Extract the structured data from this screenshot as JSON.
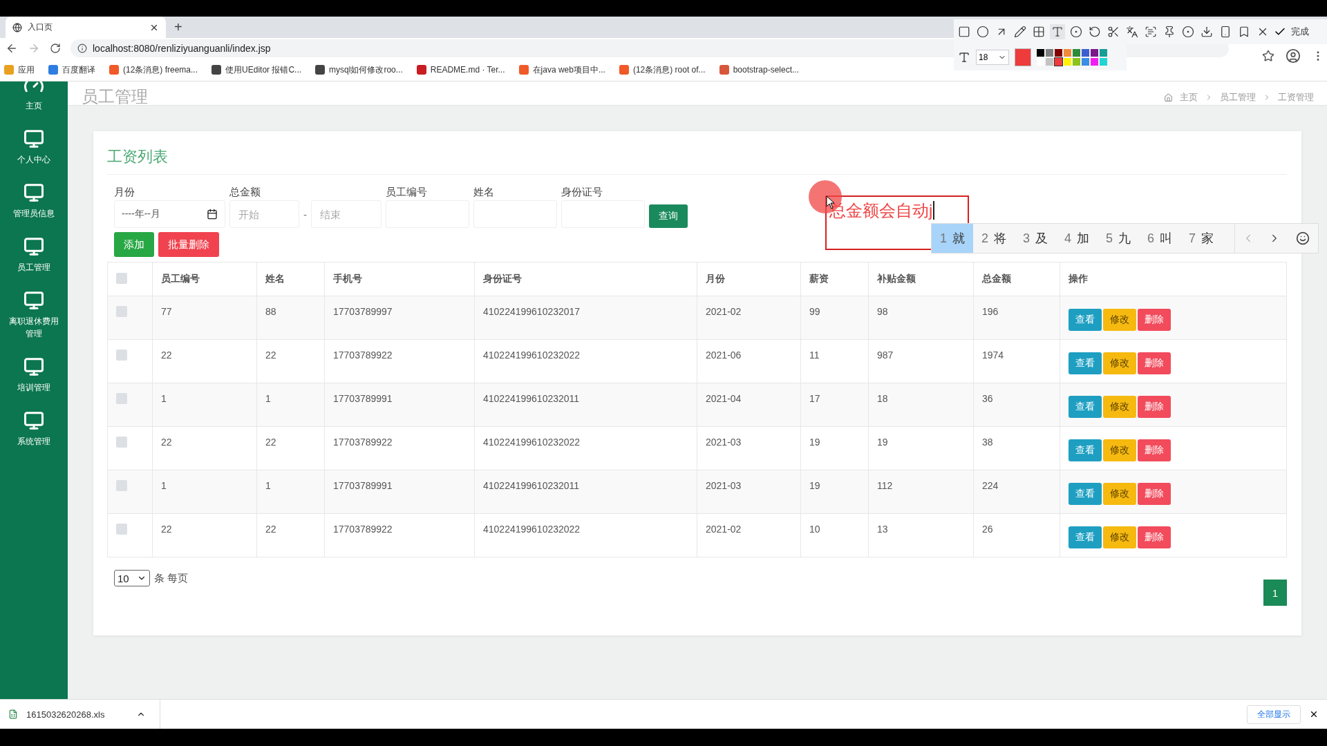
{
  "browser": {
    "tab_title": "入口页",
    "new_tab": "+",
    "url": "localhost:8080/renliziyuanguanli/index.jsp",
    "bookmarks": [
      {
        "label": "应用",
        "kind": "apps"
      },
      {
        "label": "百度翻译",
        "kind": "translate"
      },
      {
        "label": "(12条消息) freema...",
        "kind": "blog"
      },
      {
        "label": "使用UEditor 报错C...",
        "kind": "script"
      },
      {
        "label": "mysql如何修改roo...",
        "kind": "script"
      },
      {
        "label": "README.md · Ter...",
        "kind": "gitee"
      },
      {
        "label": "在java web项目中...",
        "kind": "blog"
      },
      {
        "label": "(12条消息) root of...",
        "kind": "blog"
      },
      {
        "label": "bootstrap-select...",
        "kind": "doc"
      }
    ]
  },
  "capture_toolbar": {
    "done_label": "完成",
    "font_size": "18",
    "palette": [
      {
        "color": "#000000",
        "selected": false
      },
      {
        "color": "#7f7f7f",
        "selected": false
      },
      {
        "color": "#7f0000",
        "selected": false
      },
      {
        "color": "#f08a3c",
        "selected": false
      },
      {
        "color": "#2e8b3c",
        "selected": false
      },
      {
        "color": "#3c5fd0",
        "selected": false
      },
      {
        "color": "#7a1a8a",
        "selected": false
      },
      {
        "color": "#159e96",
        "selected": false
      },
      {
        "color": "#ffffff",
        "selected": false
      },
      {
        "color": "#c3c3c3",
        "selected": false
      },
      {
        "color": "#ee3b3b",
        "selected": true
      },
      {
        "color": "#fff200",
        "selected": false
      },
      {
        "color": "#8cc21a",
        "selected": false
      },
      {
        "color": "#3a8ee6",
        "selected": false
      },
      {
        "color": "#f01ef0",
        "selected": false
      },
      {
        "color": "#22d4d4",
        "selected": false
      }
    ]
  },
  "sidebar": {
    "items": [
      {
        "label": "主页",
        "kind": "home",
        "selected": false
      },
      {
        "label": "个人中心",
        "kind": "monitor",
        "selected": false
      },
      {
        "label": "管理员信息",
        "kind": "monitor",
        "selected": false
      },
      {
        "label": "员工管理",
        "kind": "monitor",
        "selected": false
      },
      {
        "label": "离职退休费用管理",
        "kind": "monitor",
        "selected": false
      },
      {
        "label": "培训管理",
        "kind": "monitor",
        "selected": false
      },
      {
        "label": "系统管理",
        "kind": "monitor",
        "selected": false
      }
    ]
  },
  "page": {
    "title": "员工管理",
    "breadcrumb": [
      "主页",
      "员工管理",
      "工资管理"
    ]
  },
  "card": {
    "title": "工资列表",
    "filters": [
      {
        "label": "月份",
        "kind": "month",
        "value": "----年--月"
      },
      {
        "label": "总金额",
        "kind": "range",
        "placeholder_from": "开始",
        "separator": "-",
        "placeholder_to": "结束"
      },
      {
        "label": "员工编号",
        "kind": "text"
      },
      {
        "label": "姓名",
        "kind": "text"
      },
      {
        "label": "身份证号",
        "kind": "text"
      }
    ],
    "search_button": "查询",
    "buttons": [
      {
        "label": "添加",
        "kind": "add"
      },
      {
        "label": "批量删除",
        "kind": "delete"
      }
    ],
    "table": {
      "select_all_checked": false,
      "columns": [
        "员工编号",
        "姓名",
        "手机号",
        "身份证号",
        "月份",
        "薪资",
        "补贴金额",
        "总金额",
        "操作"
      ],
      "rows": [
        {
          "checked": false,
          "cells": [
            "77",
            "88",
            "17703789997",
            "410224199610232017",
            "2021-02",
            "99",
            "98",
            "196"
          ],
          "actions": [
            {
              "label": "查看",
              "kind": "view"
            },
            {
              "label": "修改",
              "kind": "edit"
            },
            {
              "label": "删除",
              "kind": "delete"
            }
          ]
        },
        {
          "checked": false,
          "cells": [
            "22",
            "22",
            "17703789922",
            "410224199610232022",
            "2021-06",
            "11",
            "987",
            "1974"
          ],
          "actions": [
            {
              "label": "查看",
              "kind": "view"
            },
            {
              "label": "修改",
              "kind": "edit"
            },
            {
              "label": "删除",
              "kind": "delete"
            }
          ]
        },
        {
          "checked": false,
          "cells": [
            "1",
            "1",
            "17703789991",
            "410224199610232011",
            "2021-04",
            "17",
            "18",
            "36"
          ],
          "actions": [
            {
              "label": "查看",
              "kind": "view"
            },
            {
              "label": "修改",
              "kind": "edit"
            },
            {
              "label": "删除",
              "kind": "delete"
            }
          ]
        },
        {
          "checked": false,
          "cells": [
            "22",
            "22",
            "17703789922",
            "410224199610232022",
            "2021-03",
            "19",
            "19",
            "38"
          ],
          "actions": [
            {
              "label": "查看",
              "kind": "view"
            },
            {
              "label": "修改",
              "kind": "edit"
            },
            {
              "label": "删除",
              "kind": "delete"
            }
          ]
        },
        {
          "checked": false,
          "cells": [
            "1",
            "1",
            "17703789991",
            "410224199610232011",
            "2021-03",
            "19",
            "112",
            "224"
          ],
          "actions": [
            {
              "label": "查看",
              "kind": "view"
            },
            {
              "label": "修改",
              "kind": "edit"
            },
            {
              "label": "删除",
              "kind": "delete"
            }
          ]
        },
        {
          "checked": false,
          "cells": [
            "22",
            "22",
            "17703789922",
            "410224199610232022",
            "2021-02",
            "10",
            "13",
            "26"
          ],
          "actions": [
            {
              "label": "查看",
              "kind": "view"
            },
            {
              "label": "修改",
              "kind": "edit"
            },
            {
              "label": "删除",
              "kind": "delete"
            }
          ]
        }
      ]
    },
    "page_size": "10",
    "page_size_label": "条 每页",
    "pages": [
      {
        "label": "1",
        "selected": true
      }
    ]
  },
  "annotation": {
    "text": "总金额会自动j"
  },
  "ime": {
    "candidates": [
      {
        "number": "1",
        "char": "就",
        "selected": true
      },
      {
        "number": "2",
        "char": "将",
        "selected": false
      },
      {
        "number": "3",
        "char": "及",
        "selected": false
      },
      {
        "number": "4",
        "char": "加",
        "selected": false
      },
      {
        "number": "5",
        "char": "九",
        "selected": false
      },
      {
        "number": "6",
        "char": "叫",
        "selected": false
      },
      {
        "number": "7",
        "char": "家",
        "selected": false
      }
    ]
  },
  "download": {
    "file": "1615032620268.xls",
    "show_all": "全部显示"
  }
}
